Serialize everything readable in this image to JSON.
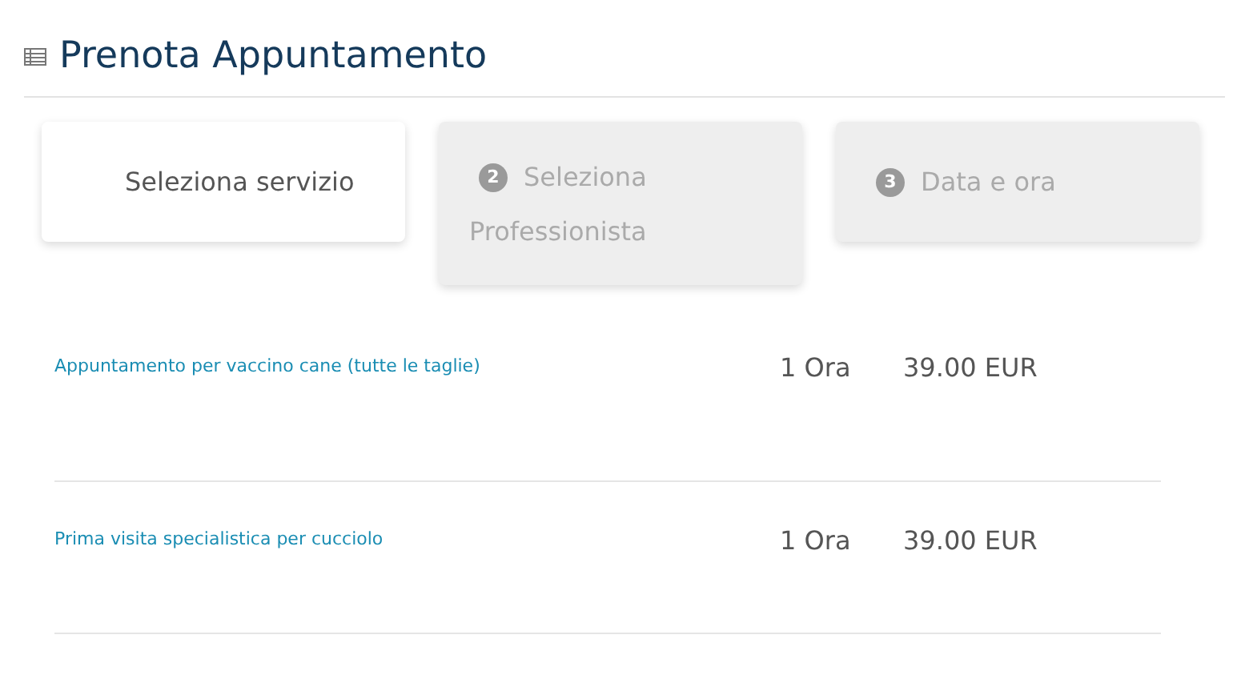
{
  "title": "Prenota Appuntamento",
  "steps": [
    {
      "label": "Seleziona servizio",
      "selected": true
    },
    {
      "number": "2",
      "label": "Seleziona Professionista",
      "selected": false
    },
    {
      "number": "3",
      "label": "Data e ora",
      "selected": false
    }
  ],
  "services": [
    {
      "name": "Appuntamento per vaccino cane (tutte le taglie)",
      "duration": "1 Ora",
      "price": "39.00 EUR"
    },
    {
      "name": "Prima visita specialistica per cucciolo",
      "duration": "1 Ora",
      "price": "39.00 EUR"
    }
  ]
}
